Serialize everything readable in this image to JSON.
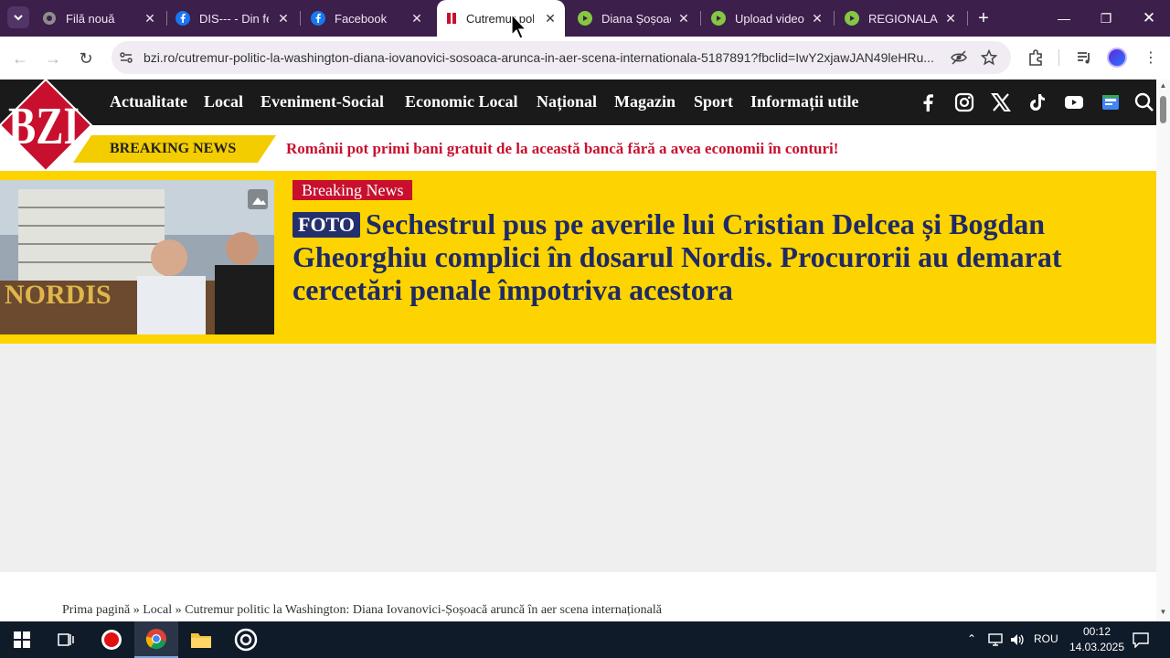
{
  "browser": {
    "tabs": [
      {
        "label": "Filă nouă",
        "favicon": "chrome-icon"
      },
      {
        "label": "DIS--- - Din fe",
        "favicon": "facebook-icon"
      },
      {
        "label": "Facebook",
        "favicon": "facebook-icon"
      },
      {
        "label": "Cutremur politi",
        "favicon": "bzi-icon",
        "active": true
      },
      {
        "label": "Diana Șoșoacă",
        "favicon": "rumble-icon"
      },
      {
        "label": "Upload video",
        "favicon": "rumble-icon"
      },
      {
        "label": "REGIONALA C",
        "favicon": "rumble-icon"
      }
    ],
    "url": "bzi.ro/cutremur-politic-la-washington-diana-iovanovici-sosoaca-arunca-in-aer-scena-internationala-5187891?fbclid=IwY2xjawJAN49leHRu..."
  },
  "site": {
    "logo_text": "BZI",
    "nav": [
      "Actualitate",
      "Local",
      "Eveniment-Social",
      "Economic Local",
      "Național",
      "Magazin",
      "Sport",
      "Informații utile"
    ],
    "breaking_label": "BREAKING NEWS",
    "breaking_text": "Românii pot primi bani gratuit de la această bancă fără a avea economii în conturi!",
    "hero": {
      "category": "Breaking News",
      "tag": "FOTO",
      "title": "Sechestrul pus pe averile lui Cristian Delcea și Bogdan Gheorghiu complici în dosarul Nordis. Procurorii au demarat cercetări penale împotriva acestora",
      "image_sign": "NORDIS"
    },
    "breadcrumb": "Prima pagină » Local » Cutremur politic la Washington: Diana Iovanovici-Șoșoacă aruncă în aer scena internațională"
  },
  "taskbar": {
    "language": "ROU",
    "time": "00:12",
    "date": "14.03.2025"
  },
  "colors": {
    "tabstrip": "#3c1f4a",
    "nav_bg": "#1a1a1a",
    "accent_yellow": "#fdd400",
    "accent_red": "#c8102e",
    "title_blue": "#1f2a64"
  }
}
